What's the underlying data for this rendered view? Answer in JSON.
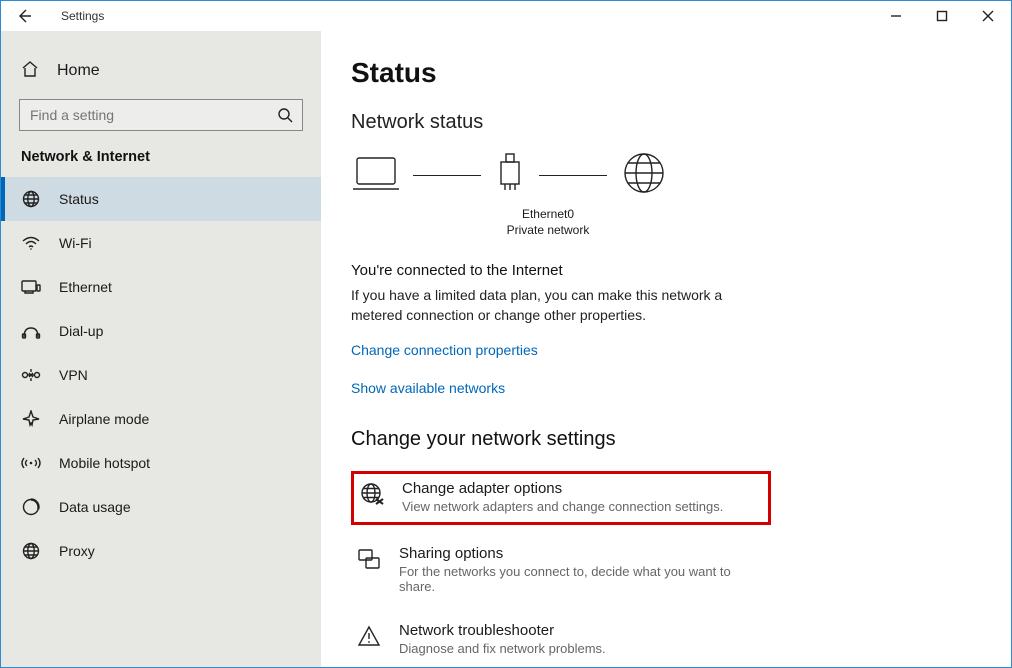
{
  "window": {
    "title": "Settings"
  },
  "sidebar": {
    "home": "Home",
    "search_placeholder": "Find a setting",
    "group": "Network & Internet",
    "items": [
      {
        "label": "Status"
      },
      {
        "label": "Wi-Fi"
      },
      {
        "label": "Ethernet"
      },
      {
        "label": "Dial-up"
      },
      {
        "label": "VPN"
      },
      {
        "label": "Airplane mode"
      },
      {
        "label": "Mobile hotspot"
      },
      {
        "label": "Data usage"
      },
      {
        "label": "Proxy"
      }
    ]
  },
  "main": {
    "heading": "Status",
    "status_heading": "Network status",
    "adapter_name": "Ethernet0",
    "adapter_profile": "Private network",
    "connected_head": "You're connected to the Internet",
    "connected_body": "If you have a limited data plan, you can make this network a metered connection or change other properties.",
    "link_change_props": "Change connection properties",
    "link_show_networks": "Show available networks",
    "change_heading": "Change your network settings",
    "options": [
      {
        "title": "Change adapter options",
        "desc": "View network adapters and change connection settings."
      },
      {
        "title": "Sharing options",
        "desc": "For the networks you connect to, decide what you want to share."
      },
      {
        "title": "Network troubleshooter",
        "desc": "Diagnose and fix network problems."
      }
    ]
  }
}
